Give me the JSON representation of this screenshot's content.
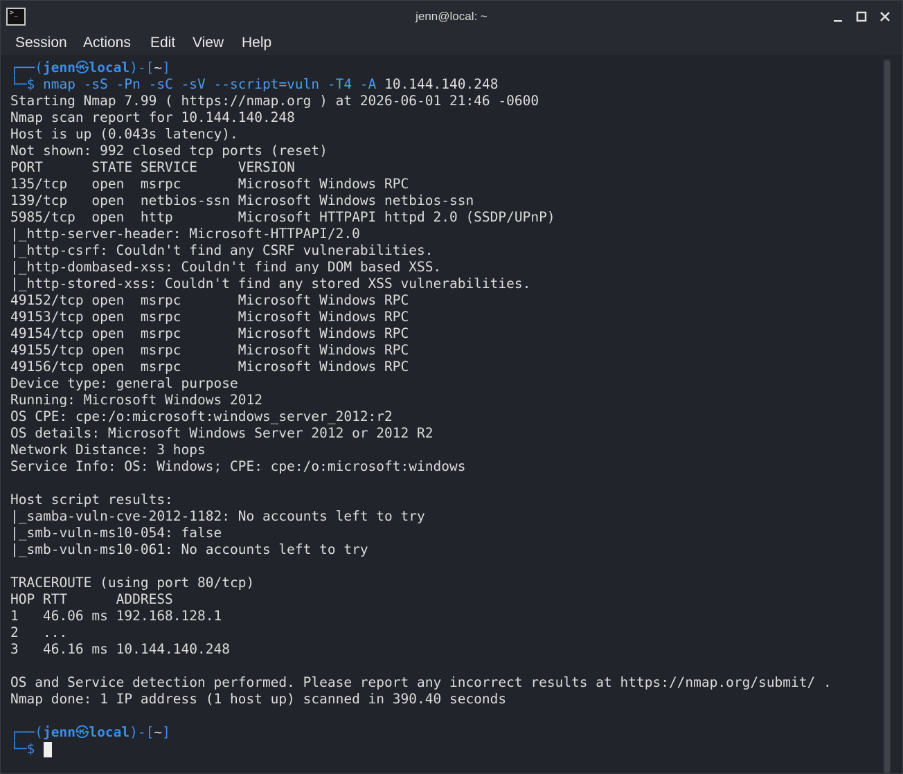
{
  "window": {
    "title": "jenn@local: ~",
    "icon": "terminal-icon",
    "controls": [
      "minimize-icon",
      "maximize-icon",
      "close-icon"
    ]
  },
  "menu": [
    "Session",
    "Actions",
    "Edit",
    "View",
    "Help"
  ],
  "prompt1": {
    "open": "┌──(",
    "user": "jenn",
    "at": "㉿",
    "host": "local",
    "close": ")-[",
    "dir": "~",
    "end": "]",
    "dollar": "└─$",
    "command": "nmap -sS -Pn -sC -sV --script=vuln -T4 -A",
    "target": "10.144.140.248"
  },
  "output": [
    "Starting Nmap 7.99 ( https://nmap.org ) at 2026-06-01 21:46 -0600",
    "Nmap scan report for 10.144.140.248",
    "Host is up (0.043s latency).",
    "Not shown: 992 closed tcp ports (reset)",
    "PORT      STATE SERVICE     VERSION",
    "135/tcp   open  msrpc       Microsoft Windows RPC",
    "139/tcp   open  netbios-ssn Microsoft Windows netbios-ssn",
    "5985/tcp  open  http        Microsoft HTTPAPI httpd 2.0 (SSDP/UPnP)",
    "|_http-server-header: Microsoft-HTTPAPI/2.0",
    "|_http-csrf: Couldn't find any CSRF vulnerabilities.",
    "|_http-dombased-xss: Couldn't find any DOM based XSS.",
    "|_http-stored-xss: Couldn't find any stored XSS vulnerabilities.",
    "49152/tcp open  msrpc       Microsoft Windows RPC",
    "49153/tcp open  msrpc       Microsoft Windows RPC",
    "49154/tcp open  msrpc       Microsoft Windows RPC",
    "49155/tcp open  msrpc       Microsoft Windows RPC",
    "49156/tcp open  msrpc       Microsoft Windows RPC",
    "Device type: general purpose",
    "Running: Microsoft Windows 2012",
    "OS CPE: cpe:/o:microsoft:windows_server_2012:r2",
    "OS details: Microsoft Windows Server 2012 or 2012 R2",
    "Network Distance: 3 hops",
    "Service Info: OS: Windows; CPE: cpe:/o:microsoft:windows",
    "",
    "Host script results:",
    "|_samba-vuln-cve-2012-1182: No accounts left to try",
    "|_smb-vuln-ms10-054: false",
    "|_smb-vuln-ms10-061: No accounts left to try",
    "",
    "TRACEROUTE (using port 80/tcp)",
    "HOP RTT      ADDRESS",
    "1   46.06 ms 192.168.128.1",
    "2   ...",
    "3   46.16 ms 10.144.140.248",
    "",
    "OS and Service detection performed. Please report any incorrect results at https://nmap.org/submit/ .",
    "Nmap done: 1 IP address (1 host up) scanned in 390.40 seconds"
  ],
  "prompt2": {
    "open": "┌──(",
    "user": "jenn",
    "at": "㉿",
    "host": "local",
    "close": ")-[",
    "dir": "~",
    "end": "]",
    "dollar": "└─$"
  },
  "colors": {
    "background": "#21242b",
    "text": "#dcdcdc",
    "prompt": "#3b8eea"
  }
}
